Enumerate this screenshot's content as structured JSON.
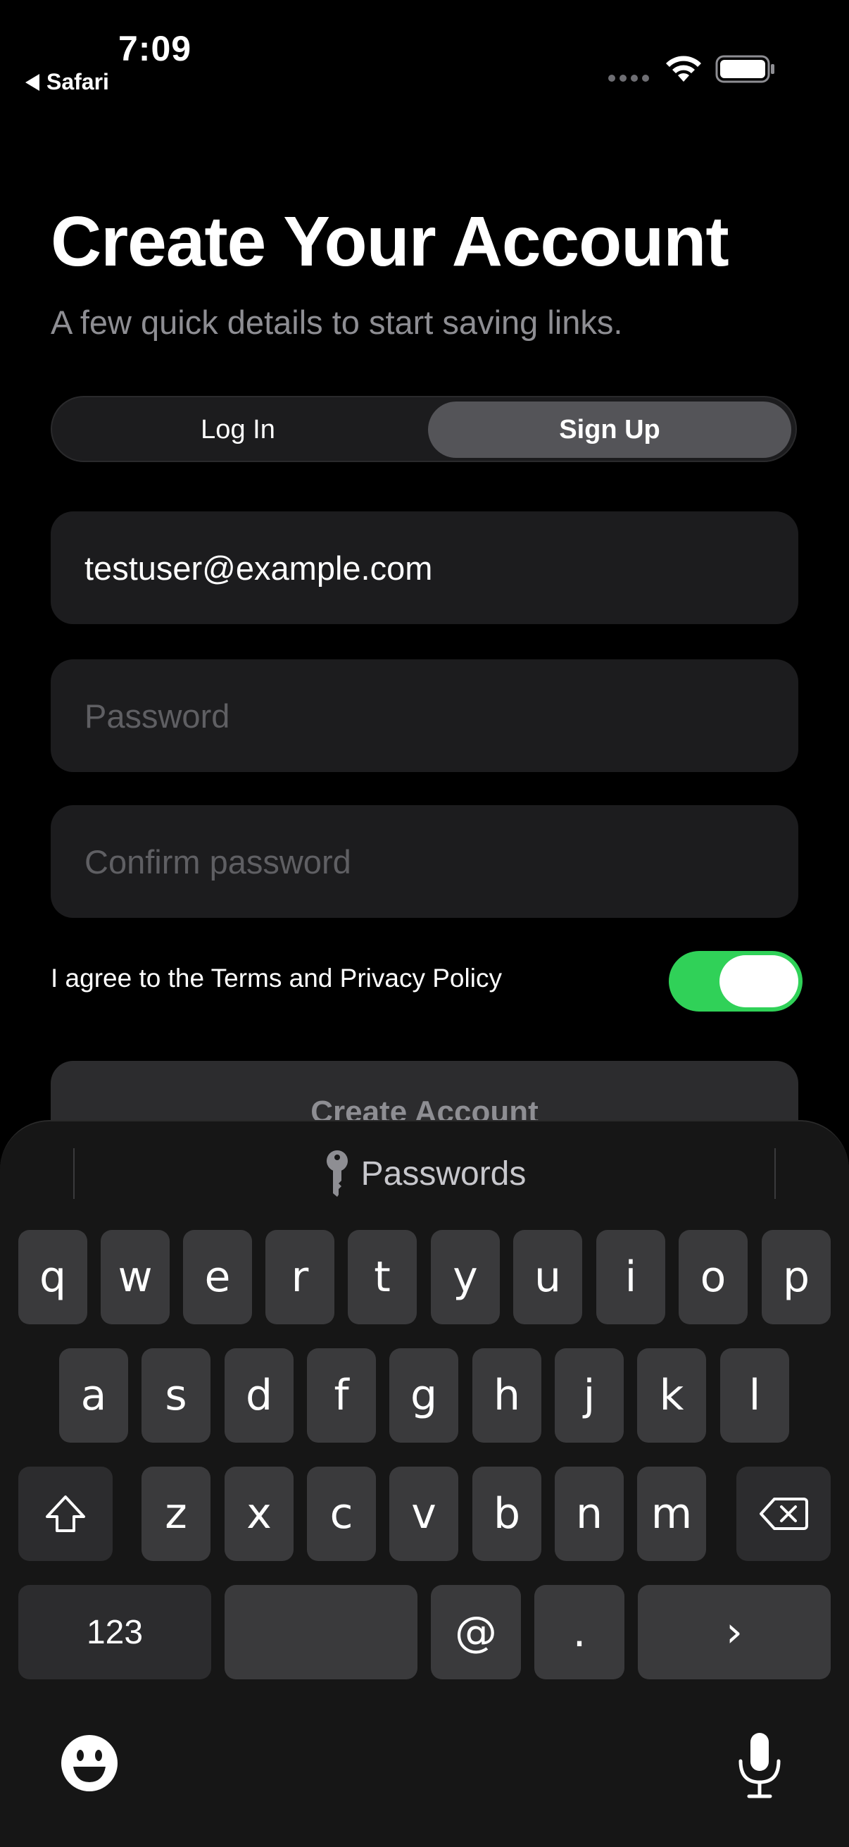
{
  "status_bar": {
    "time": "7:09",
    "back_label": "Safari"
  },
  "header": {
    "title": "Create Your Account",
    "subtitle": "A few quick details to start saving links."
  },
  "segmented_control": {
    "options": [
      "Log In",
      "Sign Up"
    ],
    "selected": "Sign Up"
  },
  "form": {
    "email_value": "testuser@example.com",
    "password_placeholder": "Password",
    "confirm_placeholder": "Confirm password",
    "agree_label": "I agree to the Terms and Privacy Policy",
    "agree_checked": true,
    "submit_label": "Create Account"
  },
  "keyboard": {
    "suggestion": "Passwords",
    "row1": [
      "q",
      "w",
      "e",
      "r",
      "t",
      "y",
      "u",
      "i",
      "o",
      "p"
    ],
    "row2": [
      "a",
      "s",
      "d",
      "f",
      "g",
      "h",
      "j",
      "k",
      "l"
    ],
    "row3": [
      "z",
      "x",
      "c",
      "v",
      "b",
      "n",
      "m"
    ],
    "numbers_label": "123",
    "at_label": "@",
    "dot_label": ".",
    "go_label": "›"
  },
  "colors": {
    "toggle_on": "#30d158",
    "background": "#000000"
  }
}
